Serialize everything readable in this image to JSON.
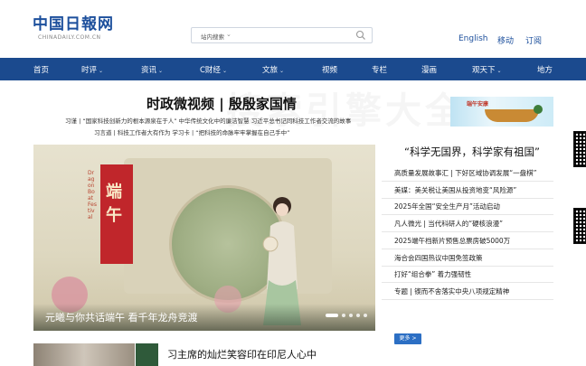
{
  "header": {
    "logo_text": "中国日報网",
    "logo_sub": "CHINADAILY.COM.CN",
    "search_label": "站内搜索",
    "links": [
      "English",
      "移动",
      "订阅"
    ]
  },
  "nav": [
    {
      "label": "首页",
      "caret": false
    },
    {
      "label": "时评",
      "caret": true
    },
    {
      "label": "资讯",
      "caret": true
    },
    {
      "label": "C财经",
      "caret": true
    },
    {
      "label": "文旅",
      "caret": true
    },
    {
      "label": "视频",
      "caret": false
    },
    {
      "label": "专栏",
      "caret": false
    },
    {
      "label": "漫画",
      "caret": false
    },
    {
      "label": "观天下",
      "caret": true
    },
    {
      "label": "地方",
      "caret": false
    }
  ],
  "headline": "时政微视频 | 殷殷家国情",
  "link_rows": [
    "习谨 | “国家科技创新力的根本源泉在于人”   中华传统文化中的廉洁智慧   习近平总书记同科技工作者交流的故事",
    "习言道 | 科技工作者大有作为   学习卡 | “把科技的命脉牢牢掌握在自己手中”"
  ],
  "banner": {
    "text": "端午安康"
  },
  "hero": {
    "red_text": "端午",
    "vertical_text": "Dragon Boat Festival",
    "caption": "元曦与你共话端午 看千年龙舟竞渡"
  },
  "right": {
    "heading": "“科学无国界，科学家有祖国”",
    "items": [
      "高质量发展故事汇 | 下好区域协调发展“一盘棋”",
      "美媒：美关税让美国从投资地变“风险源”",
      "2025年全国“安全生产月”活动启动",
      "凡人微光 | 当代科研人的“硬核浪漫”",
      "2025端午档新片预售总票房破5000万",
      "海合会四国热议中国免签政策",
      "打好“组合拳” 着力强韧性",
      "专题 | 锲而不舍落实中央八项规定精神"
    ],
    "more": "更多 >"
  },
  "bottom": {
    "title": "习主席的灿烂笑容印在印尼人心中"
  },
  "watermark": "搜索引擎大全"
}
